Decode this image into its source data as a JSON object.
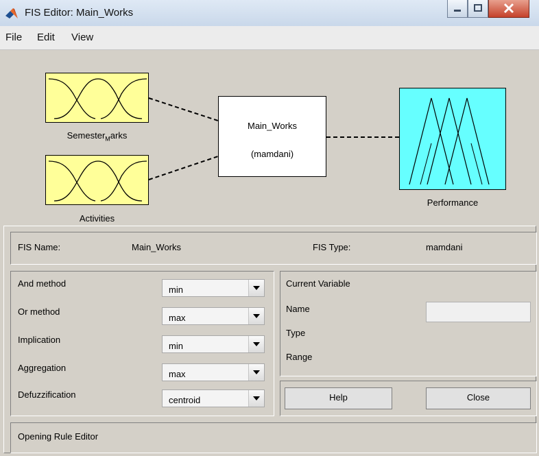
{
  "window": {
    "title": "FIS Editor: Main_Works"
  },
  "menu": {
    "items": [
      "File",
      "Edit",
      "View"
    ]
  },
  "diagram": {
    "inputs": [
      {
        "name_prefix": "Semester",
        "name_sub": "M",
        "name_suffix": "arks"
      },
      {
        "name": "Activities"
      }
    ],
    "system": {
      "name": "Main_Works",
      "type": "(mamdani)"
    },
    "output": {
      "name": "Performance"
    },
    "colors": {
      "input_fill": "#ffff99",
      "output_fill": "#66ffff"
    }
  },
  "fis_info": {
    "name_label": "FIS Name:",
    "name_value": "Main_Works",
    "type_label": "FIS Type:",
    "type_value": "mamdani"
  },
  "methods": [
    {
      "label": "And method",
      "value": "min"
    },
    {
      "label": "Or method",
      "value": "max"
    },
    {
      "label": "Implication",
      "value": "min"
    },
    {
      "label": "Aggregation",
      "value": "max"
    },
    {
      "label": "Defuzzification",
      "value": "centroid"
    }
  ],
  "current_variable": {
    "heading": "Current Variable",
    "name_label": "Name",
    "type_label": "Type",
    "range_label": "Range",
    "name_value": ""
  },
  "buttons": {
    "help": "Help",
    "close": "Close"
  },
  "status": {
    "message": "Opening Rule Editor"
  }
}
